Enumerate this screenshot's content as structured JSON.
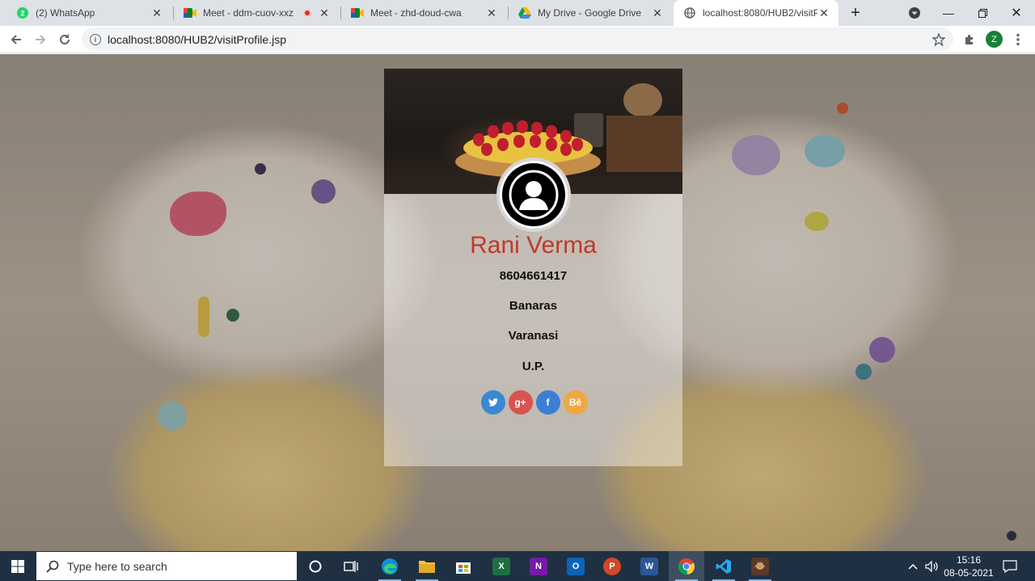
{
  "browser": {
    "tabs": [
      {
        "label": "(2) WhatsApp",
        "icon": "whatsapp-icon"
      },
      {
        "label": "Meet - ddm-cuov-xxz",
        "icon": "meet-icon"
      },
      {
        "label": "Meet - zhd-doud-cwa",
        "icon": "meet-icon"
      },
      {
        "label": "My Drive - Google Drive",
        "icon": "drive-icon"
      },
      {
        "label": "localhost:8080/HUB2/visitProfile.jsp",
        "icon": "globe-icon"
      }
    ],
    "url": "localhost:8080/HUB2/visitProfile.jsp",
    "profile_initial": "Z",
    "whatsapp_badge": "2"
  },
  "profile": {
    "name": "Rani Verma",
    "phone": "8604661417",
    "line2": "Banaras",
    "line3": "Varanasi",
    "line4": "U.P."
  },
  "socials": [
    {
      "icon": "twitter-icon",
      "glyph": "🐦",
      "color": "#3b87d4"
    },
    {
      "icon": "google-plus-icon",
      "glyph": "g+",
      "color": "#d9534f"
    },
    {
      "icon": "facebook-icon",
      "glyph": "f",
      "color": "#3b7fd4"
    },
    {
      "icon": "behance-icon",
      "glyph": "Bē",
      "color": "#eea843"
    }
  ],
  "taskbar": {
    "search_placeholder": "Type here to search",
    "time": "15:16",
    "date": "08-05-2021"
  },
  "colors": {
    "name_color": "#c0392b",
    "taskbar_bg": "#1f3042"
  }
}
